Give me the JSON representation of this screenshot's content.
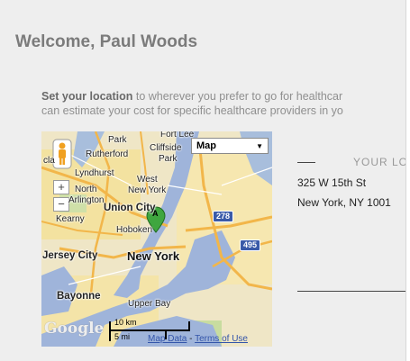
{
  "header": {
    "title": "Welcome, Paul Woods"
  },
  "intro": {
    "bold": "Set your location",
    "line1_rest": " to wherever you prefer to go for healthcar",
    "line2": "can estimate your cost for specific healthcare providers in yo"
  },
  "map": {
    "type_selector": "Map",
    "zoom_in": "+",
    "zoom_out": "−",
    "marker_label": "A",
    "labels": {
      "fort_lee": "Fort Lee",
      "park": "Park",
      "cliffside": "Cliffside",
      "park2": "Park",
      "rutherford": "Rutherford",
      "cla": "cla",
      "lyndhurst": "Lyndhurst",
      "west": "West",
      "north": "North",
      "new_york_small": "New York",
      "arlington": "Arlington",
      "union_city": "Union City",
      "kearny": "Kearny",
      "hoboken": "Hoboken",
      "jersey_city": "Jersey City",
      "new_york": "New York",
      "bayonne": "Bayonne",
      "upper_bay": "Upper Bay"
    },
    "shields": {
      "i278": "278",
      "i495": "495"
    },
    "logo": "Google",
    "scale_km": "10 km",
    "scale_mi": "5 mi",
    "map_data": "Map Data",
    "separator": " - ",
    "terms": "Terms of Use"
  },
  "location": {
    "heading": "YOUR LO",
    "address_line1": "325 W 15th St",
    "address_line2": "New York, NY 1001"
  }
}
